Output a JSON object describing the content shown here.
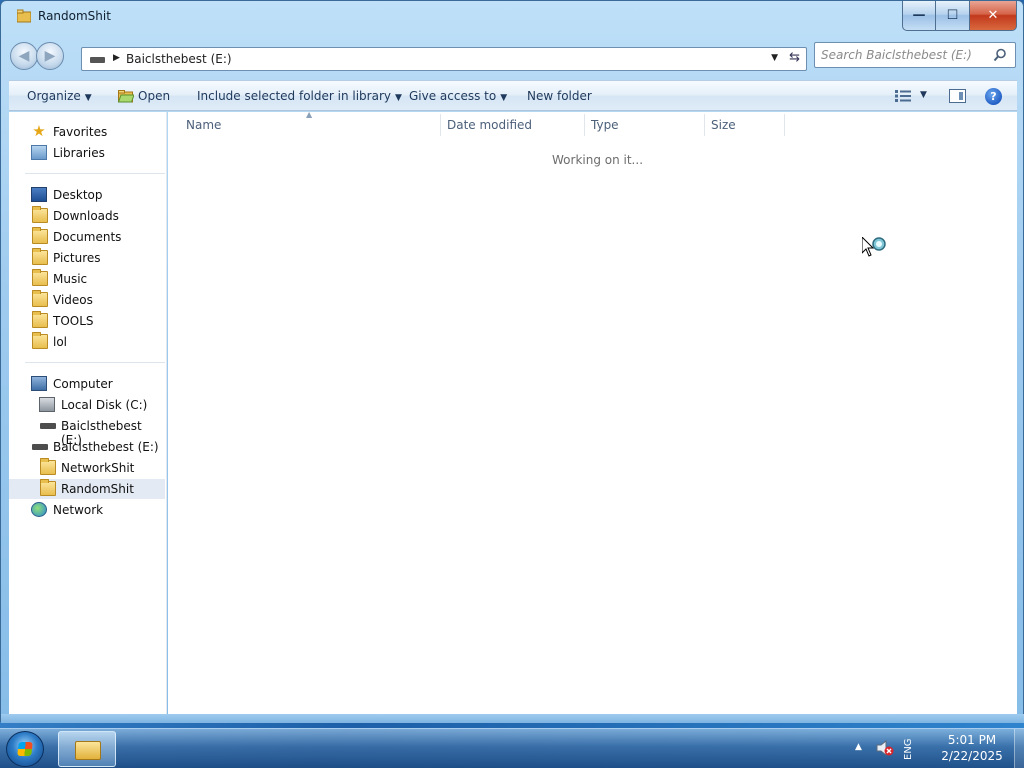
{
  "window": {
    "title": "RandomShit",
    "controls": {
      "minimize": "—",
      "maximize": "☐",
      "close": "✕"
    }
  },
  "address": {
    "path": "Baiclsthebest (E:)"
  },
  "search": {
    "placeholder": "Search Baiclsthebest (E:)"
  },
  "toolbar": {
    "organize": "Organize",
    "open": "Open",
    "include": "Include selected folder in library",
    "give_access": "Give access to",
    "new_folder": "New folder",
    "help": "?"
  },
  "nav": {
    "favorites": "Favorites",
    "libraries": "Libraries",
    "desktop": "Desktop",
    "downloads": "Downloads",
    "documents": "Documents",
    "pictures": "Pictures",
    "music": "Music",
    "videos": "Videos",
    "tools": "TOOLS",
    "lol": "lol",
    "computer": "Computer",
    "local_disk": "Local Disk (C:)",
    "drive_e_sub": "Baiclsthebest (E:)",
    "drive_e": "Baiclsthebest (E:)",
    "networkshit": "NetworkShit",
    "randomshit": "RandomShit",
    "network": "Network"
  },
  "columns": {
    "name": "Name",
    "date_modified": "Date modified",
    "type": "Type",
    "size": "Size"
  },
  "status": {
    "working": "Working on it..."
  },
  "taskbar": {
    "lang": "ENG",
    "time": "5:01 PM",
    "date": "2/22/2025"
  }
}
